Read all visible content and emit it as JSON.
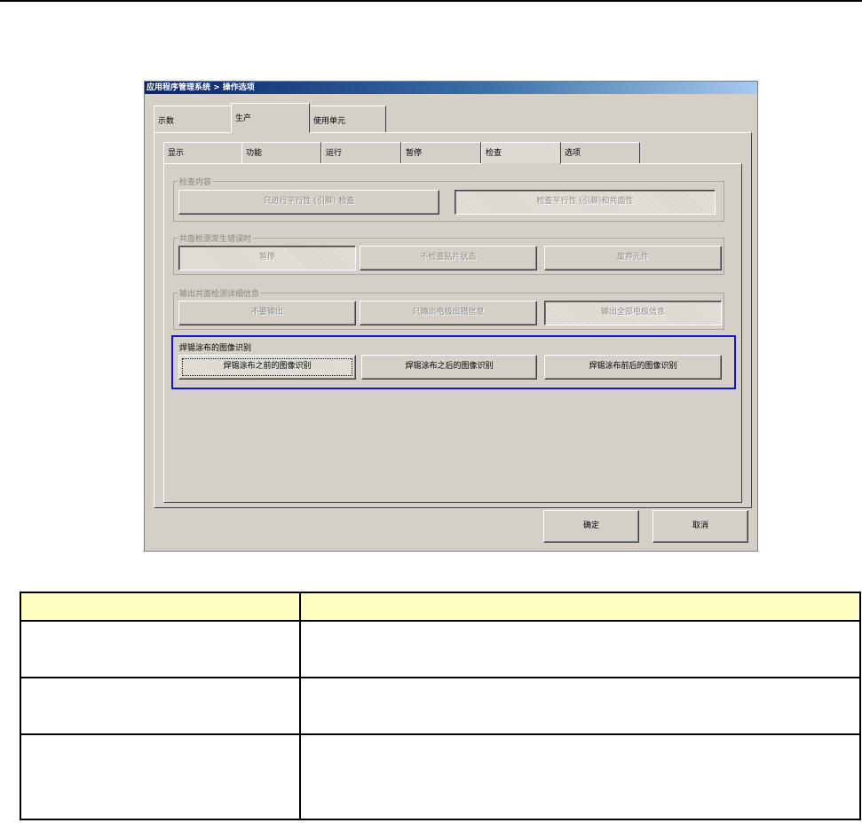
{
  "window": {
    "title": "应用程序管理系统 > 操作选项"
  },
  "top_tabs": [
    {
      "label": "示数"
    },
    {
      "label": "生产"
    },
    {
      "label": "使用单元"
    }
  ],
  "sub_tabs": [
    {
      "label": "显示"
    },
    {
      "label": "功能"
    },
    {
      "label": "运行"
    },
    {
      "label": "暂停"
    },
    {
      "label": "检查"
    },
    {
      "label": "选项"
    }
  ],
  "groups": [
    {
      "title": "检查内容",
      "buttons": [
        "只进行平行性 (引脚) 检查",
        "检查平行性 (引脚)和共面性"
      ]
    },
    {
      "title": "共面检测发生错误时",
      "buttons": [
        "暂停",
        "不检查贴片状态",
        "废弃元件"
      ]
    },
    {
      "title": "输出共面检测详细信息",
      "buttons": [
        "不要输出",
        "只输出电极出错信息",
        "输出全部电极信息"
      ]
    },
    {
      "title": "焊锡涂布的图像识别",
      "buttons": [
        "焊锡涂布之前的图像识别",
        "焊锡涂布之后的图像识别",
        "焊锡涂布前后的图像识别"
      ]
    }
  ],
  "footer": {
    "ok_label": "确定",
    "cancel_label": "取消"
  },
  "colors": {
    "highlight": "#1414d4",
    "table_header": "#fefec1"
  },
  "table": {
    "headers": [
      "",
      ""
    ],
    "rows": [
      [
        "",
        ""
      ],
      [
        "",
        ""
      ],
      [
        "",
        ""
      ]
    ]
  }
}
